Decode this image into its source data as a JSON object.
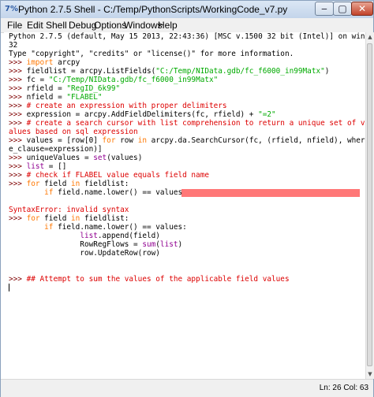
{
  "window": {
    "title": "Python 2.7.5 Shell - C:/Temp/PythonScripts/WorkingCode_v7.py",
    "icon_name": "python-shell-icon",
    "controls": {
      "minimize": "‒",
      "maximize": "▢",
      "close": "✕"
    }
  },
  "menu": [
    "File",
    "Edit",
    "Shell",
    "Debug",
    "Options",
    "Windows",
    "Help"
  ],
  "shell": {
    "lines": [
      [
        {
          "t": "Python 2.7.5 (default, May 15 2013, 22:43:36) [MSC v.1500 32 bit (Intel)] on win",
          "c": "out"
        }
      ],
      [
        {
          "t": "32",
          "c": "out"
        }
      ],
      [
        {
          "t": "Type \"copyright\", \"credits\" or \"license()\" for more information.",
          "c": "out"
        }
      ],
      [
        {
          "t": ">>> ",
          "c": "prompt"
        },
        {
          "t": "import",
          "c": "kw"
        },
        {
          "t": " arcpy",
          "c": "out"
        }
      ],
      [
        {
          "t": ">>> ",
          "c": "prompt"
        },
        {
          "t": "fieldlist = arcpy.ListFields(",
          "c": "out"
        },
        {
          "t": "\"C:/Temp/NIData.gdb/fc_f6000_in99Matx\"",
          "c": "str"
        },
        {
          "t": ")",
          "c": "out"
        }
      ],
      [
        {
          "t": ">>> ",
          "c": "prompt"
        },
        {
          "t": "fc = ",
          "c": "out"
        },
        {
          "t": "\"C:/Temp/NIData.gdb/fc_f6000_in99Matx\"",
          "c": "str"
        }
      ],
      [
        {
          "t": ">>> ",
          "c": "prompt"
        },
        {
          "t": "rfield = ",
          "c": "out"
        },
        {
          "t": "\"RegID_6k99\"",
          "c": "str"
        }
      ],
      [
        {
          "t": ">>> ",
          "c": "prompt"
        },
        {
          "t": "nfield = ",
          "c": "out"
        },
        {
          "t": "\"FLABEL\"",
          "c": "str"
        }
      ],
      [
        {
          "t": ">>> ",
          "c": "prompt"
        },
        {
          "t": "# create an expression with proper delimiters",
          "c": "cm"
        }
      ],
      [
        {
          "t": ">>> ",
          "c": "prompt"
        },
        {
          "t": "expression = arcpy.AddFieldDelimiters(fc, rfield) + ",
          "c": "out"
        },
        {
          "t": "\"=2\"",
          "c": "str"
        }
      ],
      [
        {
          "t": ">>> ",
          "c": "prompt"
        },
        {
          "t": "# create a search cursor with list comprehension to return a unique set of v",
          "c": "cm"
        }
      ],
      [
        {
          "t": "alues based on sql expression",
          "c": "cm"
        }
      ],
      [
        {
          "t": ">>> ",
          "c": "prompt"
        },
        {
          "t": "values = [row[0] ",
          "c": "out"
        },
        {
          "t": "for",
          "c": "kw"
        },
        {
          "t": " row ",
          "c": "out"
        },
        {
          "t": "in",
          "c": "kw"
        },
        {
          "t": " arcpy.da.SearchCursor(fc, (rfield, nfield), wher",
          "c": "out"
        }
      ],
      [
        {
          "t": "e_clause=expression)]",
          "c": "out"
        }
      ],
      [
        {
          "t": ">>> ",
          "c": "prompt"
        },
        {
          "t": "uniqueValues = ",
          "c": "out"
        },
        {
          "t": "set",
          "c": "bi"
        },
        {
          "t": "(values)",
          "c": "out"
        }
      ],
      [
        {
          "t": ">>> ",
          "c": "prompt"
        },
        {
          "t": "list",
          "c": "bi"
        },
        {
          "t": " = []",
          "c": "out"
        }
      ],
      [
        {
          "t": ">>> ",
          "c": "prompt"
        },
        {
          "t": "# check if FLABEL value equals field name",
          "c": "cm"
        }
      ],
      [
        {
          "t": ">>> ",
          "c": "prompt"
        },
        {
          "t": "for",
          "c": "kw"
        },
        {
          "t": " field ",
          "c": "out"
        },
        {
          "t": "in",
          "c": "kw"
        },
        {
          "t": " fieldlist:",
          "c": "out"
        }
      ],
      [
        {
          "t": "        ",
          "c": "out"
        },
        {
          "t": "if",
          "c": "kw"
        },
        {
          "t": " field.name.lower() == values",
          "c": "out"
        }
      ],
      [
        {
          "t": "",
          "c": "out"
        }
      ],
      [
        {
          "t": "SyntaxError: invalid syntax",
          "c": "err"
        }
      ],
      [
        {
          "t": ">>> ",
          "c": "prompt"
        },
        {
          "t": "for",
          "c": "kw"
        },
        {
          "t": " field ",
          "c": "out"
        },
        {
          "t": "in",
          "c": "kw"
        },
        {
          "t": " fieldlist:",
          "c": "out"
        }
      ],
      [
        {
          "t": "        ",
          "c": "out"
        },
        {
          "t": "if",
          "c": "kw"
        },
        {
          "t": " field.name.lower() == values:",
          "c": "out"
        }
      ],
      [
        {
          "t": "                ",
          "c": "out"
        },
        {
          "t": "list",
          "c": "bi"
        },
        {
          "t": ".append(field)",
          "c": "out"
        }
      ],
      [
        {
          "t": "                RowRegFlows = ",
          "c": "out"
        },
        {
          "t": "sum",
          "c": "bi"
        },
        {
          "t": "(",
          "c": "out"
        },
        {
          "t": "list",
          "c": "bi"
        },
        {
          "t": ")",
          "c": "out"
        }
      ],
      [
        {
          "t": "                row.UpdateRow(row)",
          "c": "out"
        }
      ],
      [
        {
          "t": "",
          "c": "out"
        }
      ],
      [
        {
          "t": "",
          "c": "out"
        }
      ],
      [
        {
          "t": ">>> ",
          "c": "prompt"
        },
        {
          "t": "## Attempt to sum the values of the applicable field values",
          "c": "cm"
        }
      ]
    ]
  },
  "status": {
    "text": "Ln: 26  Col: 63"
  }
}
